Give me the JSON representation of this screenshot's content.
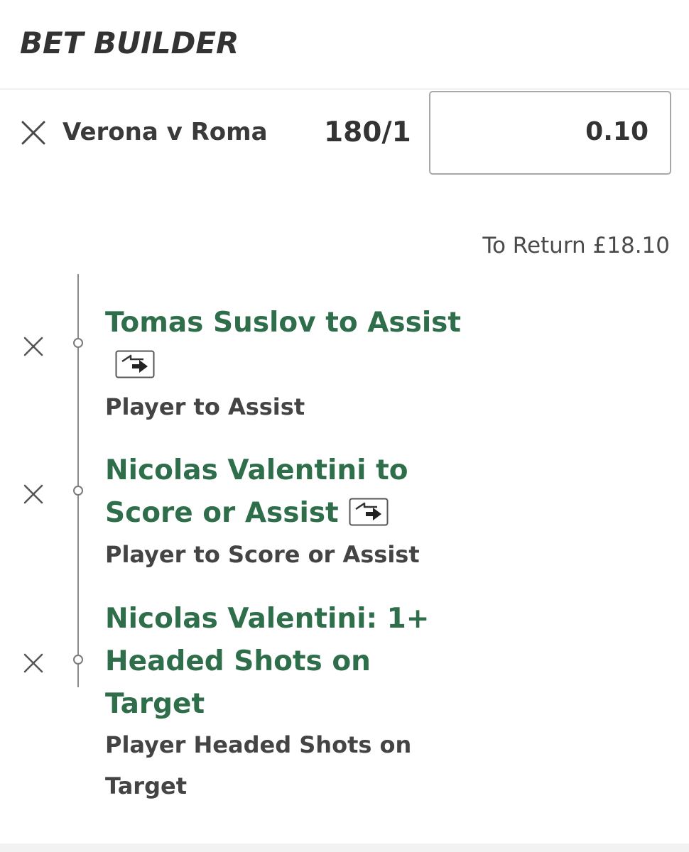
{
  "header": {
    "title": "BET BUILDER"
  },
  "selection": {
    "match": "Verona v Roma",
    "odds": "180/1",
    "stake": "0.10",
    "to_return": "To Return £18.10"
  },
  "legs": [
    {
      "title": "Tomas Suslov to Assist",
      "market": "Player to Assist",
      "icon": "swap-icon"
    },
    {
      "title": "Nicolas Valentini to Score or Assist",
      "market": "Player to Score or Assist",
      "icon": "swap-icon"
    },
    {
      "title": "Nicolas Valentini: 1+ Headed Shots on Target",
      "market": "Player Headed Shots on Target"
    }
  ],
  "colors": {
    "leg_title": "#2e6e4a",
    "text_dark": "#333333",
    "divider": "#f2f2f2",
    "stake_border": "#a8a8a8"
  }
}
